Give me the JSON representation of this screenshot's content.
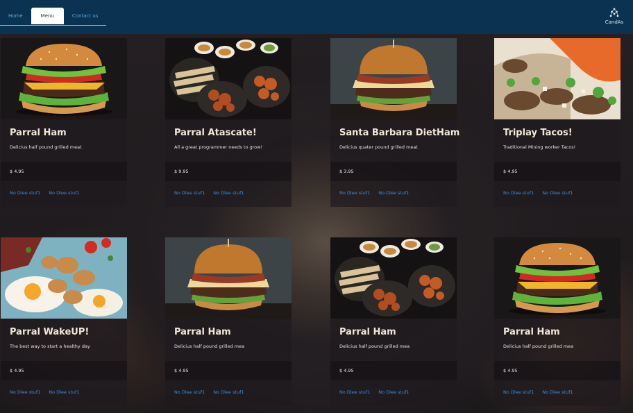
{
  "nav": {
    "tabs": [
      {
        "label": "Home"
      },
      {
        "label": "Menu"
      },
      {
        "label": "Contact us"
      }
    ],
    "brand": "CandAs"
  },
  "colors": {
    "navbar": "#0b3351",
    "link": "#3d8fe0",
    "tab_text": "#56a8e6"
  },
  "cards": [
    {
      "title": "Parral Ham",
      "description": "Delicius half pound grilled meat",
      "price": "$ 4.95",
      "links": [
        "No Dlee stuf1",
        "No Dlee stuf1"
      ],
      "image": "burger"
    },
    {
      "title": "Parral Atascate!",
      "description": "All a great programmer needs to grow!",
      "price": "$ 9.95",
      "links": [
        "No Dlee stuf1",
        "No Dlee stuf1"
      ],
      "image": "platter"
    },
    {
      "title": "Santa Barbara DietHam",
      "description": "Delicius quater pound grilled meat",
      "price": "$ 3.95",
      "links": [
        "No Dlee stuf1",
        "No Dlee stuf1"
      ],
      "image": "burger-bacon"
    },
    {
      "title": "Triplay Tacos!",
      "description": "Traditional Mining worker Tacos!",
      "price": "$ 4.95",
      "links": [
        "No Dlee stuf1",
        "No Dlee stuf1"
      ],
      "image": "tacos"
    },
    {
      "title": "Parral WakeUP!",
      "description": "The best way to start a healthy day",
      "price": "$ 4.95",
      "links": [
        "No Dlee stuf1",
        "No Dlee stuf1"
      ],
      "image": "breakfast"
    },
    {
      "title": "Parral Ham",
      "description": "Delicius half pound grilled mea",
      "price": "$ 4.95",
      "links": [
        "No Dlee stuf1",
        "No Dlee stuf1"
      ],
      "image": "burger-bacon"
    },
    {
      "title": "Parral Ham",
      "description": "Delicius half pound grilled mea",
      "price": "$ 4.95",
      "links": [
        "No Dlee stuf1",
        "No Dlee stuf1"
      ],
      "image": "platter"
    },
    {
      "title": "Parral Ham",
      "description": "Delicius half pound grilled mea",
      "price": "$ 4.95",
      "links": [
        "No Dlee stuf1",
        "No Dlee stuf1"
      ],
      "image": "burger"
    }
  ]
}
